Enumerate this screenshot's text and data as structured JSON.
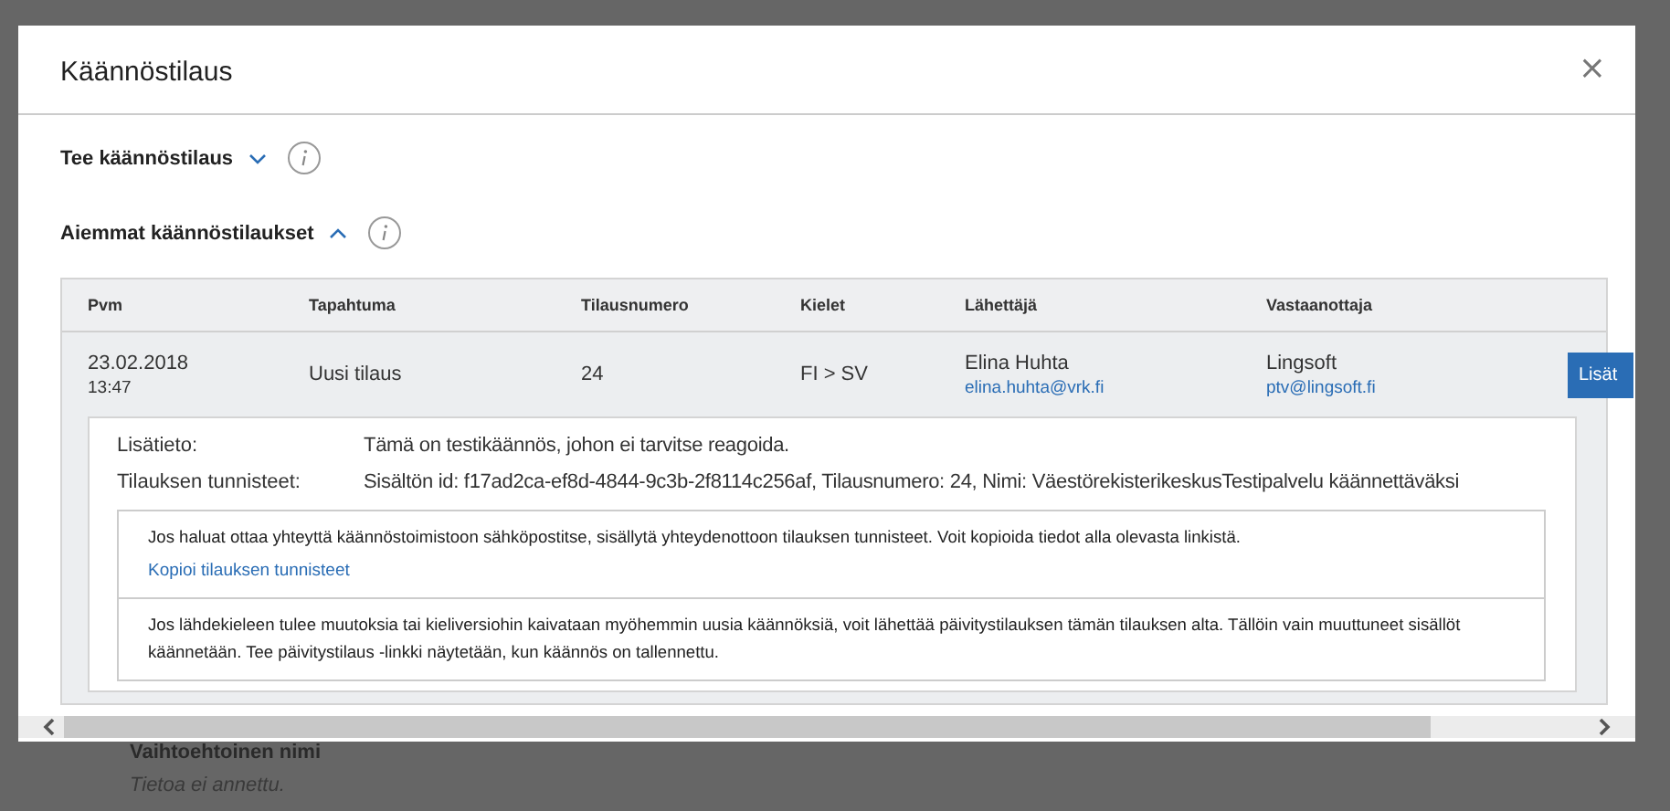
{
  "dialog": {
    "title": "Käännöstilaus",
    "close": "×"
  },
  "sections": [
    {
      "title": "Tee käännöstilaus",
      "expanded": false
    },
    {
      "title": "Aiemmat käännöstilaukset",
      "expanded": true
    }
  ],
  "table": {
    "columns": [
      "Pvm",
      "Tapahtuma",
      "Tilausnumero",
      "Kielet",
      "Lähettäjä",
      "Vastaanottaja"
    ],
    "rows": [
      {
        "date": "23.02.2018",
        "time": "13:47",
        "event": "Uusi tilaus",
        "order_number": "24",
        "languages": "FI > SV",
        "sender": {
          "name": "Elina Huhta",
          "email": "elina.huhta@vrk.fi"
        },
        "recipient": {
          "name": "Lingsoft",
          "email": "ptv@lingsoft.fi"
        },
        "action": "Lisät",
        "expanded": true,
        "details": {
          "fields": [
            {
              "label": "Lisätieto:",
              "value": "Tämä on testikäännös, johon ei tarvitse reagoida."
            },
            {
              "label": "Tilauksen tunnisteet:",
              "value": "Sisältön id: f17ad2ca-ef8d-4844-9c3b-2f8114c256af, Tilausnumero: 24, Nimi: VäestörekisterikeskusTestipalvelu käännettäväksi"
            }
          ],
          "notices": [
            {
              "text": "Jos haluat ottaa yhteyttä käännöstoimistoon sähköpostitse, sisällytä yhteydenottoon tilauksen tunnisteet. Voit kopioida tiedot alla olevasta linkistä.",
              "link": "Kopioi tilauksen tunnisteet"
            },
            {
              "text": "Jos lähdekieleen tulee muutoksia tai kieliversiohin kaivataan myöhemmin uusia käännöksiä, voit lähettää päivitystilauksen tämän tilauksen alta. Tällöin vain muuttuneet sisällöt käännetään. Tee päivitystilaus -linkki näytetään, kun käännös on tallennettu."
            }
          ]
        }
      }
    ]
  },
  "background": {
    "heading": "Vaihtoehtoinen nimi",
    "text": "Tietoa ei annettu."
  }
}
